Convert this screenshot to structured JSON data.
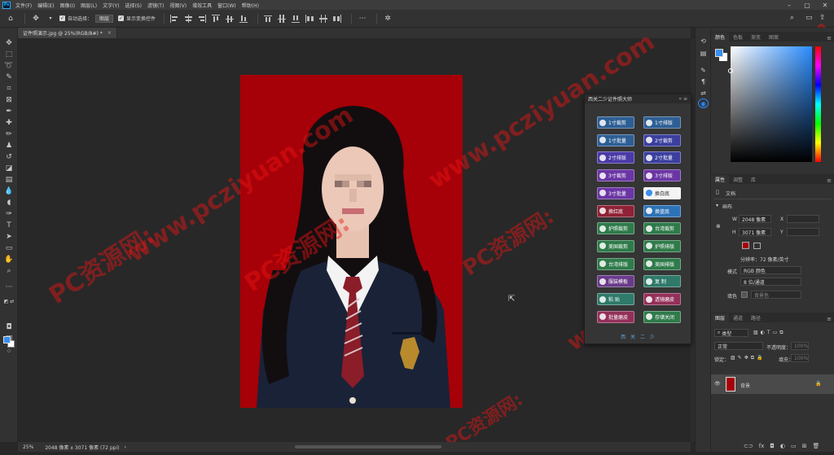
{
  "app": {
    "logo": "Ps",
    "menu": [
      "文件(F)",
      "编辑(E)",
      "图像(I)",
      "图层(L)",
      "文字(Y)",
      "选择(S)",
      "滤镜(T)",
      "视图(V)",
      "增效工具",
      "窗口(W)",
      "帮助(H)"
    ]
  },
  "options": {
    "auto_select_label": "自动选择：",
    "auto_select_value": "图层",
    "show_transform_label": "显示变换控件"
  },
  "document": {
    "tab_title": "证件照演示.jpg @ 25%(RGB/8#) *",
    "close": "×"
  },
  "status": {
    "zoom": "25%",
    "info": "2048 像素 x 3071 像素 (72 ppi)",
    "arrow": "›"
  },
  "color_panel": {
    "tabs": [
      "颜色",
      "色板",
      "渐变",
      "图案"
    ]
  },
  "properties_panel": {
    "tabs": [
      "属性",
      "调整",
      "库"
    ],
    "doc_label": "文档",
    "canvas_label": "画布",
    "w_label": "W",
    "w_value": "2048 像素",
    "x_label": "X",
    "h_label": "H",
    "h_value": "3071 像素",
    "y_label": "Y",
    "resolution": "分辨率：72 像素/英寸",
    "mode_label": "模式",
    "mode_value": "RGB 颜色",
    "depth_value": "8 位/通道",
    "fill_label": "填色",
    "fill_value": "背景色"
  },
  "layers_panel": {
    "tabs": [
      "图层",
      "通道",
      "路径"
    ],
    "filter_label": "类型",
    "blend_mode": "正常",
    "opacity_label": "不透明度：",
    "opacity_value": "100%",
    "lock_label": "锁定：",
    "fill_label": "填充：",
    "fill_value": "100%",
    "layer_name": "背景"
  },
  "plugin": {
    "title": "西关二少证件照大师",
    "controls": "« ≡",
    "footer": "西 关 二 少",
    "buttons": [
      {
        "label": "1寸裁剪",
        "color": "#2e5f94"
      },
      {
        "label": "1寸排版",
        "color": "#2e5f94"
      },
      {
        "label": "1寸批量",
        "color": "#2e5f94"
      },
      {
        "label": "2寸裁剪",
        "color": "#3b3f9e"
      },
      {
        "label": "2寸排版",
        "color": "#4a3aa6"
      },
      {
        "label": "2寸批量",
        "color": "#3b3f9e"
      },
      {
        "label": "3寸裁剪",
        "color": "#6b36a4"
      },
      {
        "label": "3寸排版",
        "color": "#6b36a4"
      },
      {
        "label": "3寸批量",
        "color": "#6b36a4"
      },
      {
        "label": "换白底",
        "color": "#f4f4f4"
      },
      {
        "label": "换红底",
        "color": "#8f2236"
      },
      {
        "label": "换蓝底",
        "color": "#2d72b6"
      },
      {
        "label": "护照裁剪",
        "color": "#2f7a4a"
      },
      {
        "label": "台湾裁剪",
        "color": "#2f7a4a"
      },
      {
        "label": "美国裁剪",
        "color": "#2f7a4a"
      },
      {
        "label": "护照排版",
        "color": "#2f7a4a"
      },
      {
        "label": "台湾排版",
        "color": "#2f7a4a"
      },
      {
        "label": "美国排版",
        "color": "#2f7a4a"
      },
      {
        "label": "服装模板",
        "color": "#6a3a8a"
      },
      {
        "label": "复 制",
        "color": "#2f7a6a"
      },
      {
        "label": "粘 贴",
        "color": "#2f7a6a"
      },
      {
        "label": "透镜磨皮",
        "color": "#93305a"
      },
      {
        "label": "批量磨皮",
        "color": "#93305a"
      },
      {
        "label": "存储关闭",
        "color": "#2f7a4a"
      }
    ]
  },
  "watermark": {
    "text_url": "www.pcziyuan.com",
    "text_cn": "PC资源网:"
  },
  "icons": {
    "home": "home-icon",
    "move": "move-icon",
    "search": "search-icon",
    "settings": "gear-icon"
  }
}
